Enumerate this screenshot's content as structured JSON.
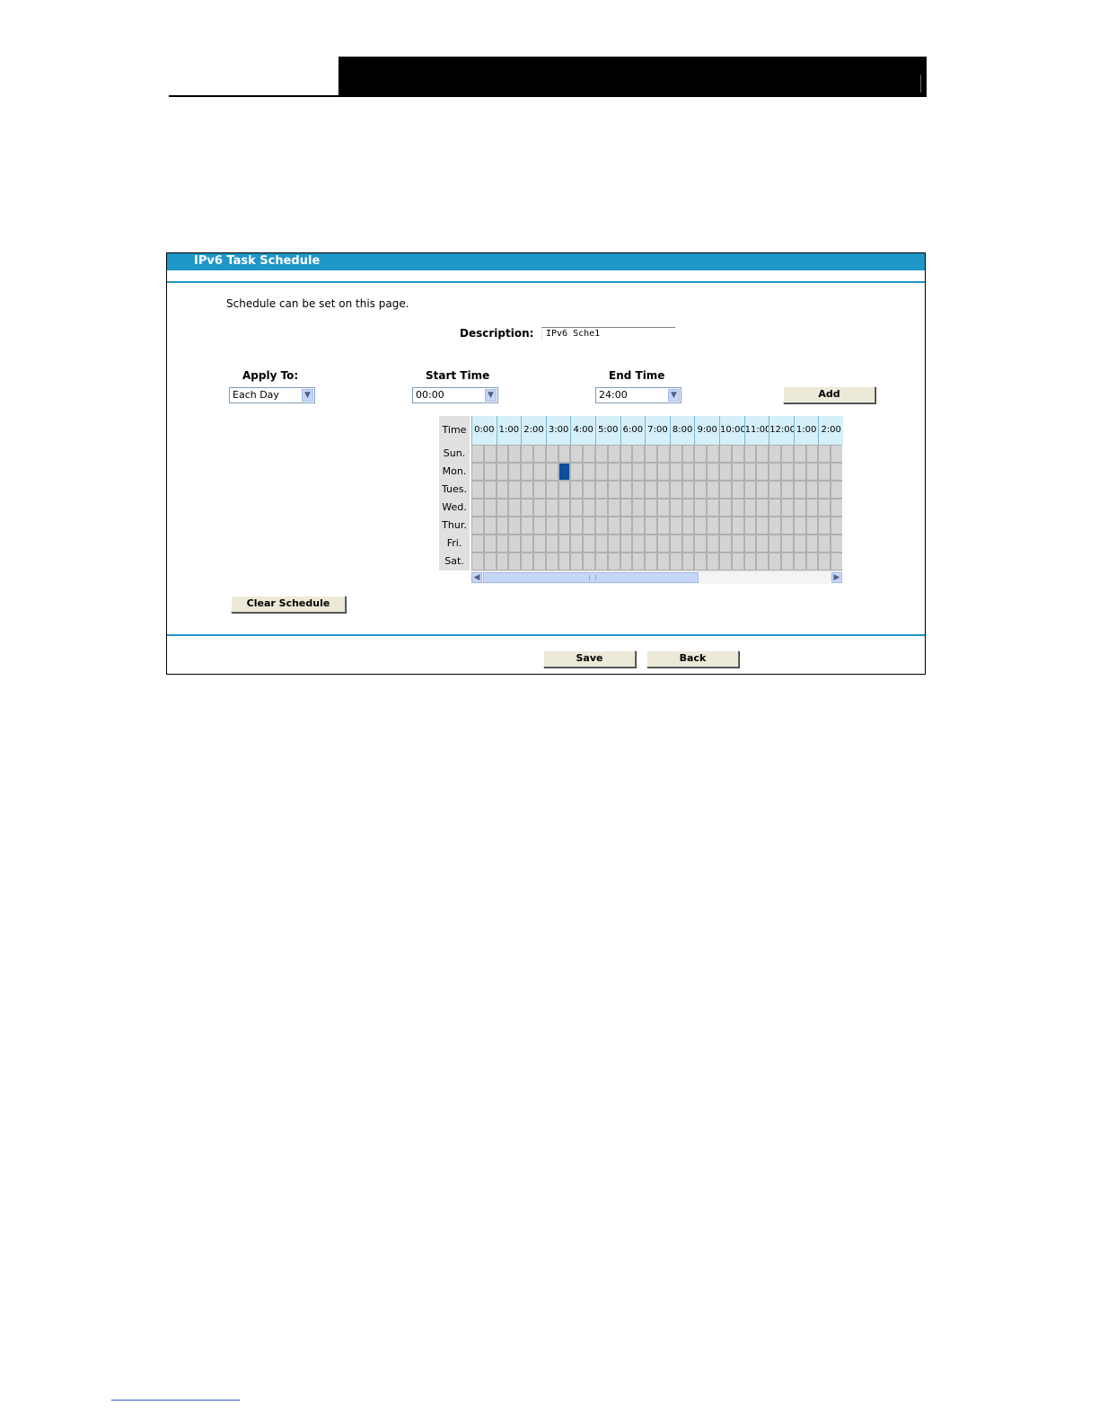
{
  "panel": {
    "title": "IPv6 Task Schedule",
    "intro": "Schedule can be set on this page."
  },
  "form": {
    "description_label": "Description:",
    "description_value": "IPv6 Sche1",
    "apply_to_label": "Apply To:",
    "apply_to_value": "Each Day",
    "start_time_label": "Start Time",
    "start_time_value": "00:00",
    "end_time_label": "End Time",
    "end_time_value": "24:00",
    "add_label": "Add"
  },
  "schedule": {
    "time_label": "Time",
    "hours": [
      "0:00",
      "1:00",
      "2:00",
      "3:00",
      "4:00",
      "5:00",
      "6:00",
      "7:00",
      "8:00",
      "9:00",
      "10:00",
      "11:00",
      "12:00",
      "1:00",
      "2:00"
    ],
    "days": [
      "Sun.",
      "Mon.",
      "Tues.",
      "Wed.",
      "Thur.",
      "Fri.",
      "Sat."
    ],
    "selected": [
      {
        "day": "Mon.",
        "hour": "3:00",
        "half": 2
      }
    ],
    "colors": {
      "header": "#d6f0fa",
      "cell": "#d4d4d4",
      "selected": "#0a4e9c"
    }
  },
  "buttons": {
    "clear_schedule": "Clear Schedule",
    "save": "Save",
    "back": "Back"
  },
  "colors": {
    "accent": "#1f96c8"
  }
}
